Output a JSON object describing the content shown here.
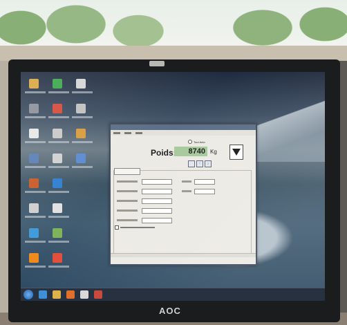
{
  "monitor": {
    "brand": "AOC"
  },
  "app": {
    "radio_label": "Tout Auto",
    "weight_label": "Poids:",
    "weight_value": "8740",
    "weight_unit": "Kg",
    "btn_up": "↑",
    "btn_down": "↓"
  },
  "desktop_icons": [
    {
      "name": "desktop-icon-1",
      "color": "#d9a540"
    },
    {
      "name": "desktop-icon-2",
      "color": "#8b8f98"
    },
    {
      "name": "desktop-icon-3",
      "color": "#e7e7e7"
    },
    {
      "name": "desktop-icon-4",
      "color": "#5b7fb5"
    },
    {
      "name": "desktop-icon-5",
      "color": "#c85b2a"
    },
    {
      "name": "desktop-icon-6",
      "color": "#cfcfcf"
    },
    {
      "name": "desktop-icon-7",
      "color": "#3f9ad8"
    },
    {
      "name": "desktop-icon-8",
      "color": "#ef8a1d"
    },
    {
      "name": "desktop-icon-9",
      "color": "#3aa54a"
    },
    {
      "name": "desktop-icon-10",
      "color": "#d44a3a"
    },
    {
      "name": "desktop-icon-11",
      "color": "#c9c9c9"
    },
    {
      "name": "desktop-icon-12",
      "color": "#d1d1d1"
    },
    {
      "name": "desktop-icon-13",
      "color": "#2f7fd0"
    },
    {
      "name": "desktop-icon-14",
      "color": "#e1e1e1"
    },
    {
      "name": "desktop-icon-15",
      "color": "#7fb35a"
    },
    {
      "name": "desktop-icon-16",
      "color": "#e24e3c"
    },
    {
      "name": "desktop-icon-17",
      "color": "#d5d5d5"
    },
    {
      "name": "desktop-icon-18",
      "color": "#c0c0c0"
    },
    {
      "name": "desktop-icon-19",
      "color": "#d79b3e"
    },
    {
      "name": "desktop-icon-20",
      "color": "#5b8bcf"
    }
  ],
  "taskbar_items": [
    {
      "name": "taskbar-ie-icon",
      "color": "#3f8fd8"
    },
    {
      "name": "taskbar-folder-icon",
      "color": "#e0b24a"
    },
    {
      "name": "taskbar-media-icon",
      "color": "#e06f2a"
    },
    {
      "name": "taskbar-app-icon",
      "color": "#d9d9d9"
    },
    {
      "name": "taskbar-app2-icon",
      "color": "#c94a3c"
    }
  ]
}
